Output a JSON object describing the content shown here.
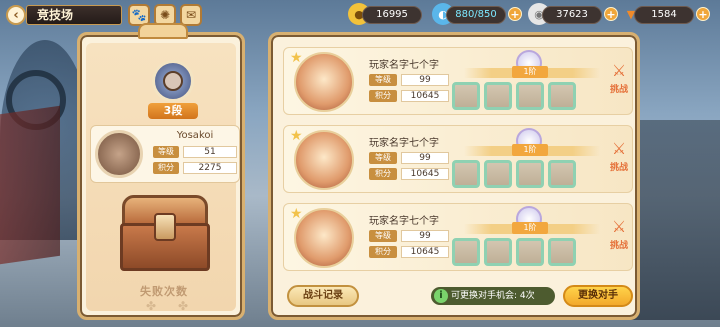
{
  "header": {
    "title": "竞技场",
    "icons": [
      "paw-icon",
      "compass-icon",
      "map-icon"
    ]
  },
  "resources": {
    "coins": "16995",
    "stamina": "880/850",
    "gems": "37623",
    "carrots": "1584"
  },
  "player": {
    "rank": "3段",
    "name": "Yosakoi",
    "level_label": "等级",
    "level": "51",
    "score_label": "积分",
    "score": "2275",
    "fail_count_label": "失败次数"
  },
  "opponents": [
    {
      "name": "玩家名字七个字",
      "rank": "1阶",
      "level_label": "等级",
      "level": "99",
      "score_label": "积分",
      "score": "10645",
      "fight_label": "挑战"
    },
    {
      "name": "玩家名字七个字",
      "rank": "1阶",
      "level_label": "等级",
      "level": "99",
      "score_label": "积分",
      "score": "10645",
      "fight_label": "挑战"
    },
    {
      "name": "玩家名字七个字",
      "rank": "1阶",
      "level_label": "等级",
      "level": "99",
      "score_label": "积分",
      "score": "10645",
      "fight_label": "挑战"
    }
  ],
  "footer": {
    "battle_log": "战斗记录",
    "refresh_chances": "可更换对手机会: 4次",
    "refresh_button": "更换对手"
  },
  "colors": {
    "accent": "#f3a92b",
    "panel": "#fbf1dc",
    "border": "#d8b070",
    "fight": "#e5713a"
  }
}
